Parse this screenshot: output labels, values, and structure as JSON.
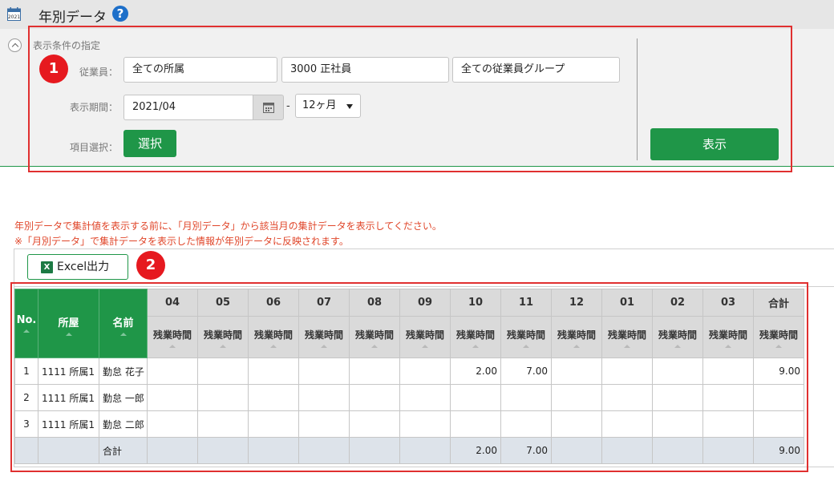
{
  "header": {
    "calendar_icon_text": "2021",
    "title": "年別データ",
    "help": "?"
  },
  "conditions": {
    "section_title": "表示条件の指定",
    "employee_label": "従業員：",
    "department": "全ての所属",
    "employment_type": "3000 正社員",
    "employee_group": "全ての従業員グループ",
    "period_label": "表示期間：",
    "start_month": "2021/04",
    "dash": "-",
    "months": "12ヶ月",
    "item_label": "項目選択：",
    "select_button": "選択",
    "show_button": "表示"
  },
  "annotations": {
    "badge1": "1",
    "badge2": "2"
  },
  "notices": [
    "年別データで集計値を表示する前に、「月別データ」から該当月の集計データを表示してください。",
    "※「月別データ」で集計データを表示した情報が年別データに反映されます。"
  ],
  "toolbar": {
    "excel_icon": "X",
    "excel_button": "Excel出力"
  },
  "table": {
    "headers": {
      "no": "No.",
      "dept": "所屋",
      "name": "名前",
      "months": [
        "04",
        "05",
        "06",
        "07",
        "08",
        "09",
        "10",
        "11",
        "12",
        "01",
        "02",
        "03"
      ],
      "total": "合計",
      "sub": "残業時間"
    },
    "rows": [
      {
        "no": "1",
        "dept": "1111 所属1",
        "name": "勤怠 花子",
        "values": [
          "",
          "",
          "",
          "",
          "",
          "",
          "2.00",
          "7.00",
          "",
          "",
          "",
          ""
        ],
        "total": "9.00"
      },
      {
        "no": "2",
        "dept": "1111 所属1",
        "name": "勤怠 一郎",
        "values": [
          "",
          "",
          "",
          "",
          "",
          "",
          "",
          "",
          "",
          "",
          "",
          ""
        ],
        "total": ""
      },
      {
        "no": "3",
        "dept": "1111 所属1",
        "name": "勤怠 二郎",
        "values": [
          "",
          "",
          "",
          "",
          "",
          "",
          "",
          "",
          "",
          "",
          "",
          ""
        ],
        "total": ""
      }
    ],
    "total_row": {
      "label": "合計",
      "values": [
        "",
        "",
        "",
        "",
        "",
        "",
        "2.00",
        "7.00",
        "",
        "",
        "",
        ""
      ],
      "total": "9.00"
    }
  }
}
